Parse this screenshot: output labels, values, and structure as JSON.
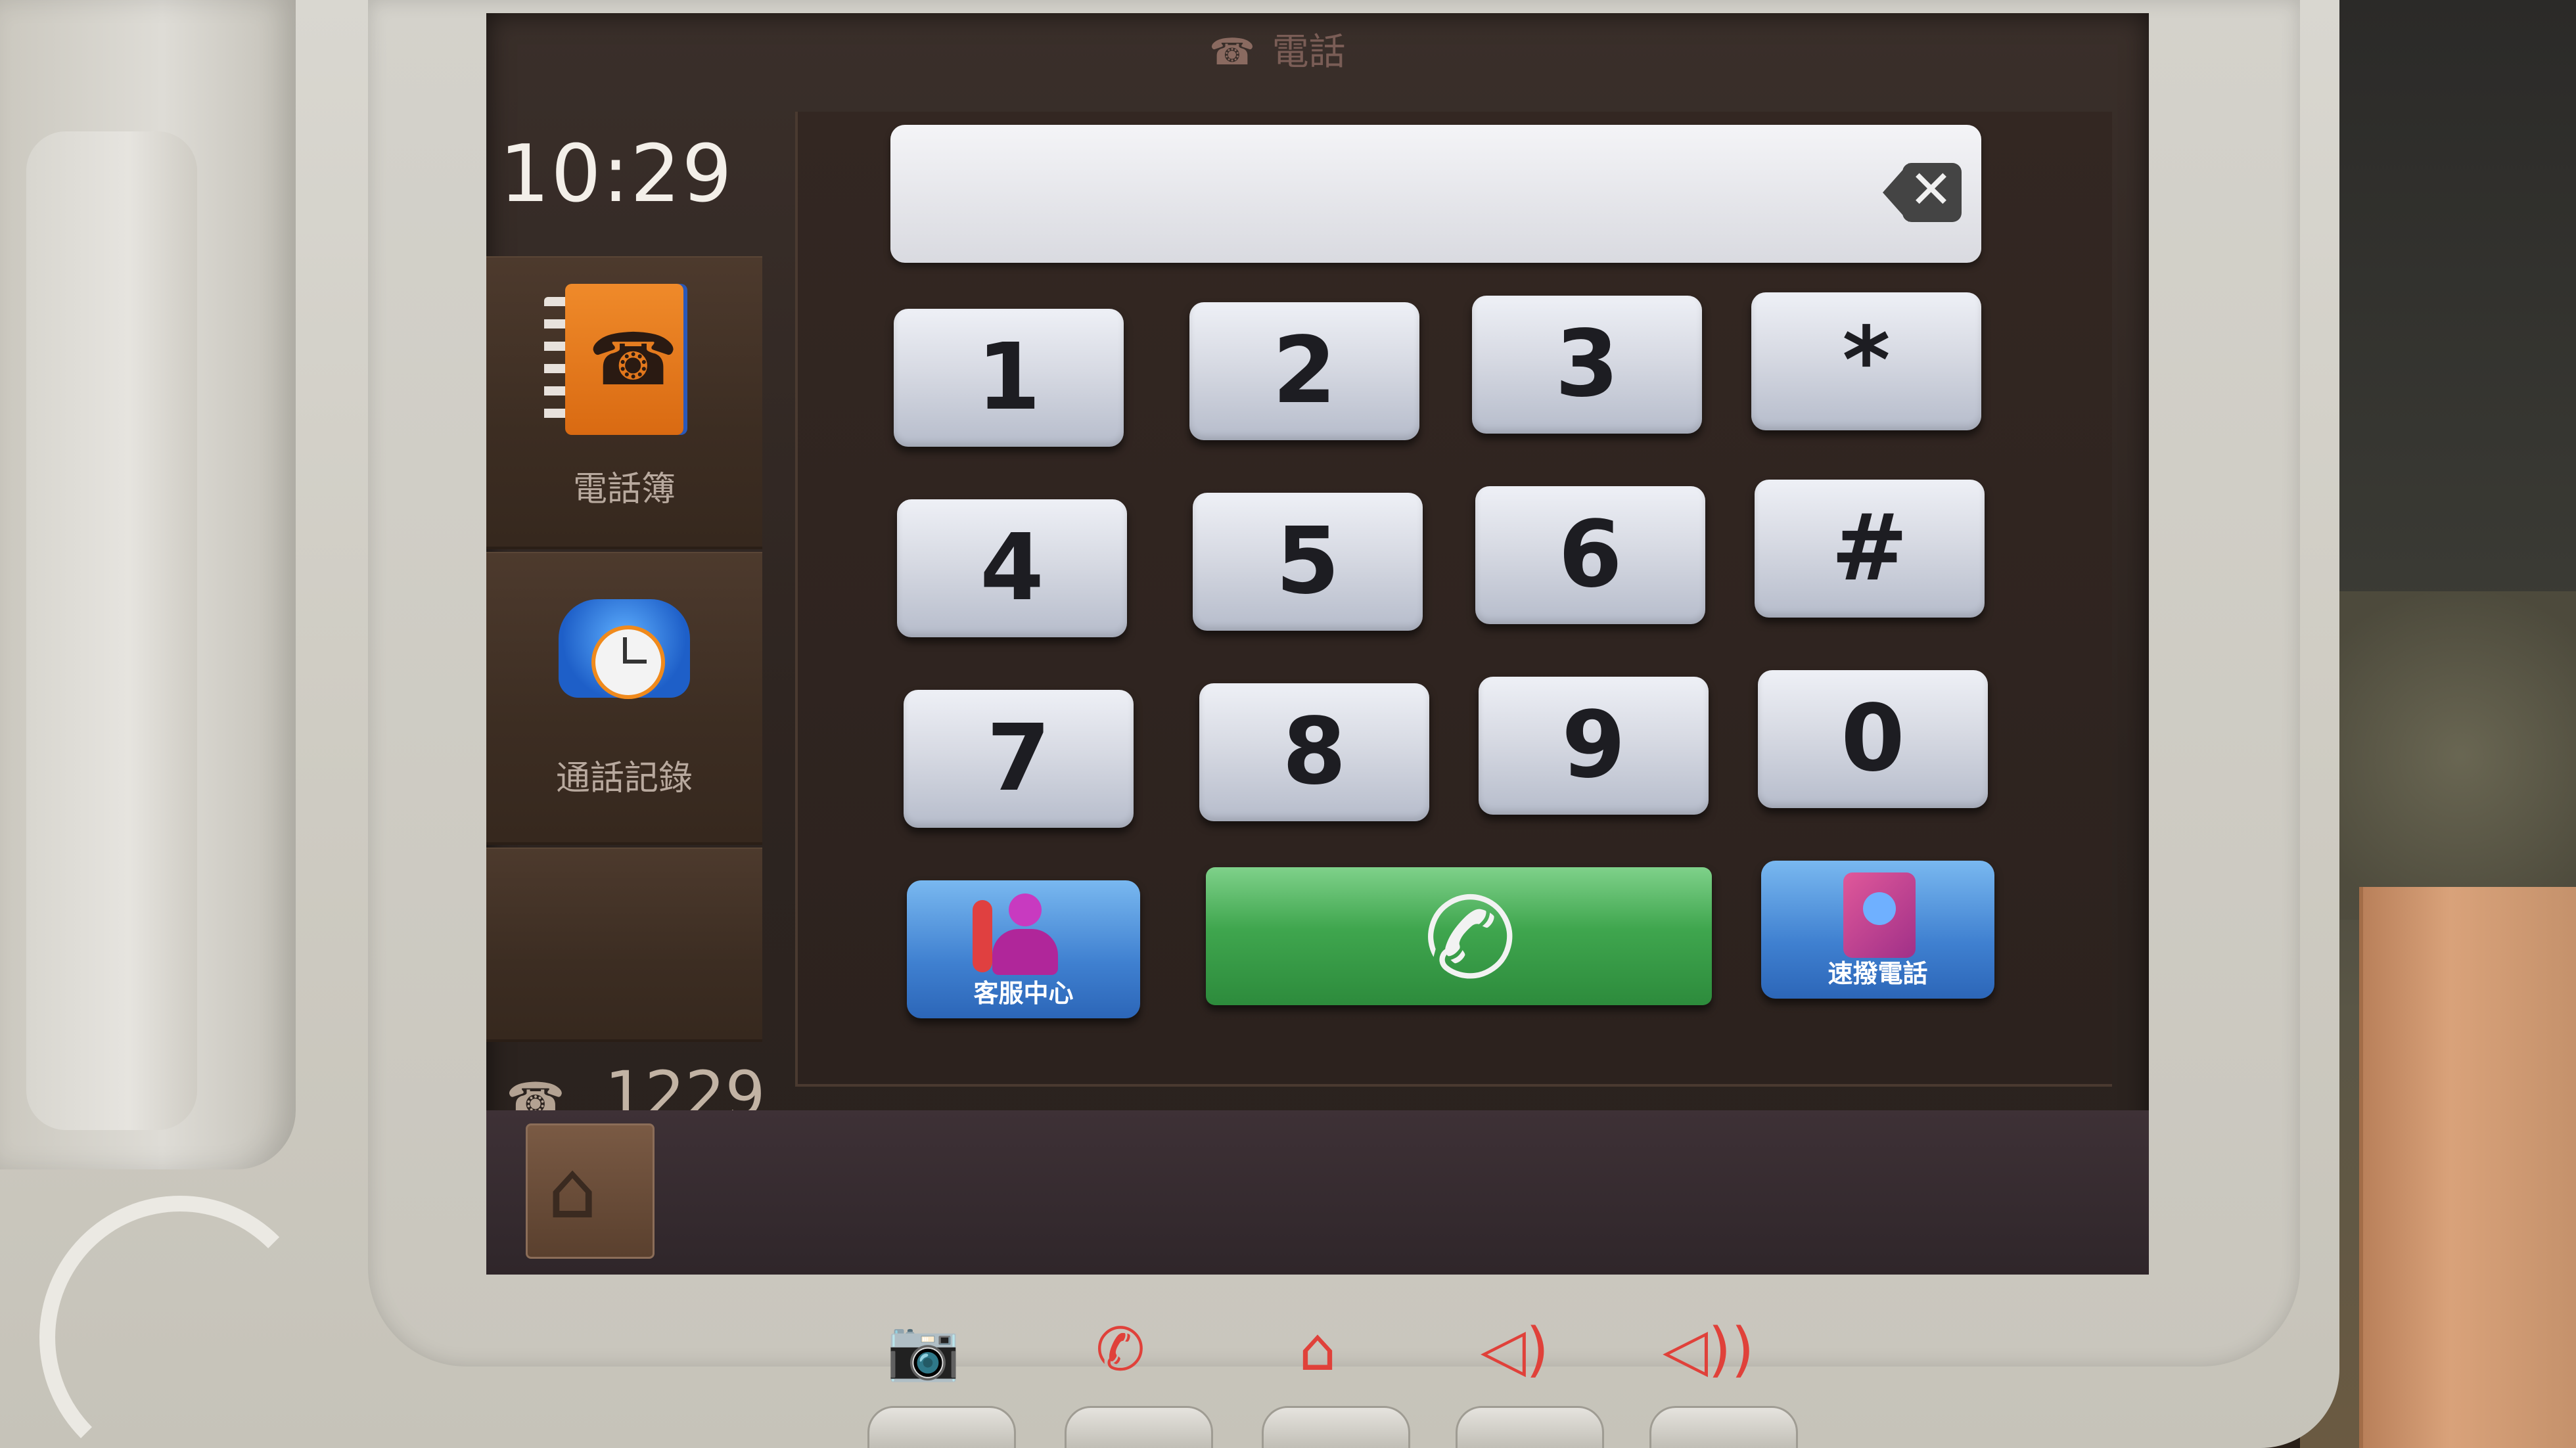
{
  "screen": {
    "title": "電話",
    "title_icon": "☎",
    "clock": "10:29",
    "extension": "1229",
    "extension_icon": "☎"
  },
  "sidebar": {
    "items": [
      {
        "label": "電話簿",
        "icon": "phonebook-icon"
      },
      {
        "label": "通話記錄",
        "icon": "call-log-icon"
      }
    ]
  },
  "dialer": {
    "number_value": "",
    "keys": [
      "1",
      "2",
      "3",
      "*",
      "4",
      "5",
      "6",
      "#",
      "7",
      "8",
      "9",
      "0"
    ],
    "service_center_label": "客服中心",
    "speed_dial_label": "速撥電話",
    "call_icon": "✆",
    "backspace_icon": "✕"
  },
  "home": {
    "icon": "⌂"
  },
  "hardware_keys": [
    {
      "name": "camera",
      "glyph": "📷"
    },
    {
      "name": "handset",
      "glyph": "✆"
    },
    {
      "name": "home",
      "glyph": "⌂"
    },
    {
      "name": "volume-down",
      "glyph": "◁)"
    },
    {
      "name": "volume-up",
      "glyph": "◁))"
    }
  ],
  "colors": {
    "call_green": "#3fa64e",
    "accent_blue": "#3f80d0",
    "hardware_red": "#e0413a"
  }
}
